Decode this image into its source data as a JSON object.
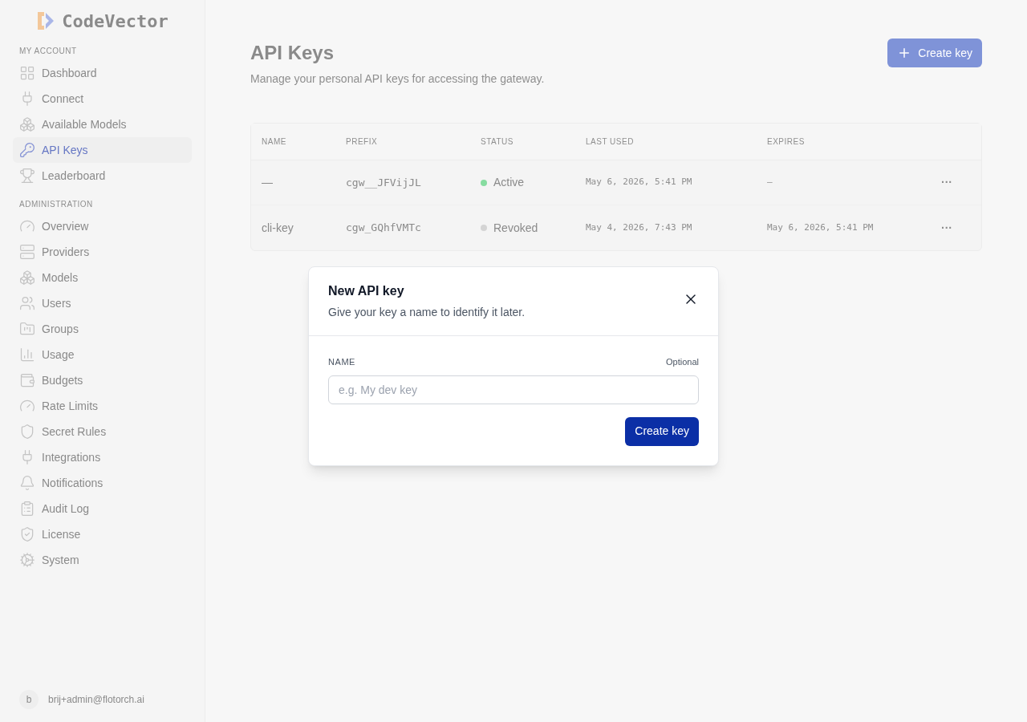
{
  "sidebar": {
    "brand": "CodeVector",
    "sections": [
      {
        "heading": "MY ACCOUNT",
        "items": [
          {
            "label": "Dashboard",
            "selected": false
          },
          {
            "label": "Connect",
            "selected": false
          },
          {
            "label": "Available Models",
            "selected": false
          },
          {
            "label": "API Keys",
            "selected": true
          },
          {
            "label": "Leaderboard",
            "selected": false
          }
        ]
      },
      {
        "heading": "ADMINISTRATION",
        "items": [
          {
            "label": "Overview",
            "selected": false
          },
          {
            "label": "Providers",
            "selected": false
          },
          {
            "label": "Models",
            "selected": false
          },
          {
            "label": "Users",
            "selected": false
          },
          {
            "label": "Groups",
            "selected": false
          },
          {
            "label": "Usage",
            "selected": false
          },
          {
            "label": "Budgets",
            "selected": false
          },
          {
            "label": "Rate Limits",
            "selected": false
          },
          {
            "label": "Secret Rules",
            "selected": false
          },
          {
            "label": "Integrations",
            "selected": false
          },
          {
            "label": "Notifications",
            "selected": false
          },
          {
            "label": "Audit Log",
            "selected": false
          },
          {
            "label": "License",
            "selected": false
          },
          {
            "label": "System",
            "selected": false
          }
        ]
      }
    ],
    "user": {
      "initial": "b",
      "email": "brij+admin@flotorch.ai"
    }
  },
  "page": {
    "title": "API Keys",
    "subtitle": "Manage your personal API keys for accessing the gateway.",
    "create_button": "Create key"
  },
  "table": {
    "columns": [
      "NAME",
      "PREFIX",
      "STATUS",
      "LAST USED",
      "EXPIRES"
    ],
    "rows": [
      {
        "name": "—",
        "prefix": "cgw__JFVijJL",
        "status": "Active",
        "color": "#86dca0",
        "last_used": "May 6, 2026, 5:41 PM",
        "expires": "—",
        "menu": "···"
      },
      {
        "name": "cli-key",
        "prefix": "cgw_GQhfVMTc",
        "status": "Revoked",
        "color": "#d4d4d4",
        "last_used": "May 4, 2026, 7:43 PM",
        "expires": "May 6, 2026, 5:41 PM",
        "menu": "···"
      }
    ]
  },
  "dialog": {
    "title": "New API key",
    "subtitle": "Give your key a name to identify it later.",
    "field_label": "NAME",
    "field_hint": "Optional",
    "placeholder": "e.g. My dev key",
    "submit": "Create key"
  }
}
